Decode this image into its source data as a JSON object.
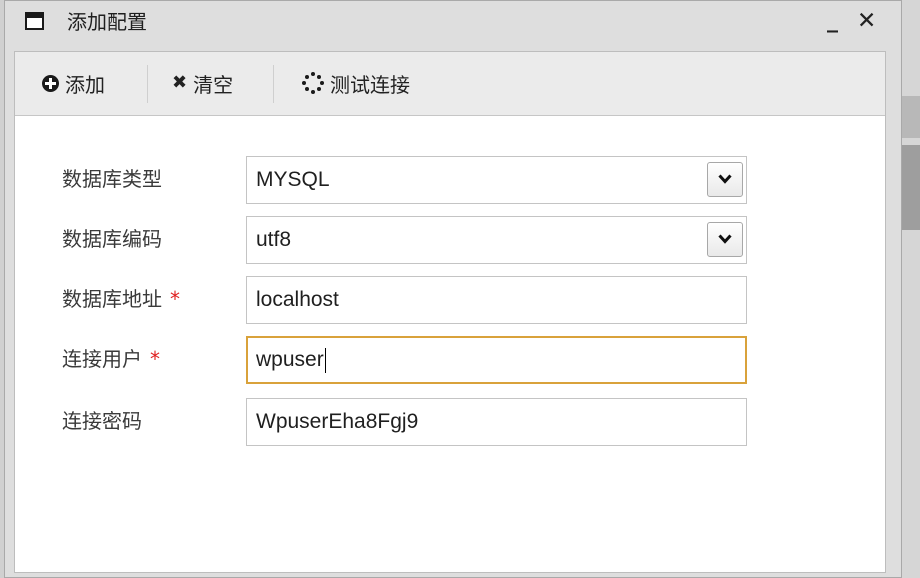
{
  "window": {
    "title": "添加配置",
    "minimize_label": "_",
    "close_label": "✕"
  },
  "toolbar": {
    "add_label": "添加",
    "clear_label": "清空",
    "test_label": "测试连接"
  },
  "form": {
    "db_type": {
      "label": "数据库类型",
      "value": "MYSQL"
    },
    "db_encoding": {
      "label": "数据库编码",
      "value": "utf8"
    },
    "db_address": {
      "label": "数据库地址",
      "required_mark": "*",
      "value": "localhost"
    },
    "conn_user": {
      "label": "连接用户",
      "required_mark": "*",
      "value": "wpuser"
    },
    "conn_password": {
      "label": "连接密码",
      "value": "WpuserEha8Fgj9"
    }
  },
  "colors": {
    "required": "#e02020",
    "focus_border": "#d9a23b"
  },
  "icons": [
    "window-icon",
    "plus-circle-icon",
    "times-icon",
    "spinner-icon",
    "chevron-down-icon"
  ]
}
